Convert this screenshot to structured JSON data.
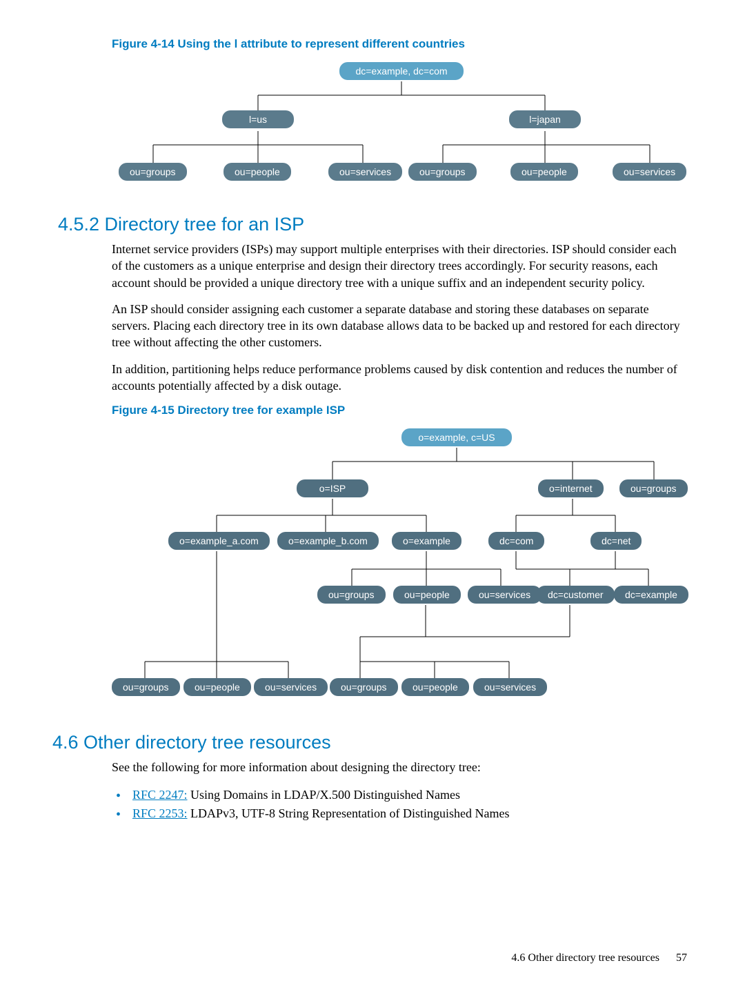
{
  "fig14": {
    "caption": "Figure 4-14 Using the l attribute to represent different countries",
    "root": "dc=example, dc=com",
    "left_mid": "l=us",
    "right_mid": "l=japan",
    "leaves_left": [
      "ou=groups",
      "ou=people",
      "ou=services"
    ],
    "leaves_right": [
      "ou=groups",
      "ou=people",
      "ou=services"
    ]
  },
  "section452": {
    "heading": "4.5.2 Directory tree for an ISP",
    "p1": "Internet service providers (ISPs) may support multiple enterprises with their directories. ISP should consider each of the customers as a unique enterprise and design their directory trees accordingly. For security reasons, each account should be provided a unique directory tree with a unique suffix and an independent security policy.",
    "p2": "An ISP should consider assigning each customer a separate database and storing these databases on separate servers. Placing each directory tree in its own database allows data to be backed up and restored for each directory tree without affecting the other customers.",
    "p3": "In addition, partitioning helps reduce performance problems caused by disk contention and reduces the number of accounts potentially affected by a disk outage."
  },
  "fig15": {
    "caption": "Figure 4-15 Directory tree for example ISP",
    "root": "o=example, c=US",
    "r2": {
      "a": "o=ISP",
      "b": "o=internet",
      "c": "ou=groups"
    },
    "r3": {
      "a": "o=example_a.com",
      "b": "o=example_b.com",
      "c": "o=example",
      "d": "dc=com",
      "e": "dc=net"
    },
    "r4": {
      "a": "ou=groups",
      "b": "ou=people",
      "c": "ou=services",
      "d": "dc=customer",
      "e": "dc=example"
    },
    "r5": [
      "ou=groups",
      "ou=people",
      "ou=services",
      "ou=groups",
      "ou=people",
      "ou=services"
    ]
  },
  "section46": {
    "heading": "4.6 Other directory tree resources",
    "intro": "See the following for more information about designing the directory tree:",
    "b1_link": "RFC 2247:",
    "b1_rest": " Using Domains in LDAP/X.500 Distinguished Names",
    "b2_link": "RFC 2253:",
    "b2_rest": " LDAPv3, UTF-8 String Representation of Distinguished Names"
  },
  "footer": {
    "text": "4.6 Other directory tree resources",
    "page": "57"
  }
}
